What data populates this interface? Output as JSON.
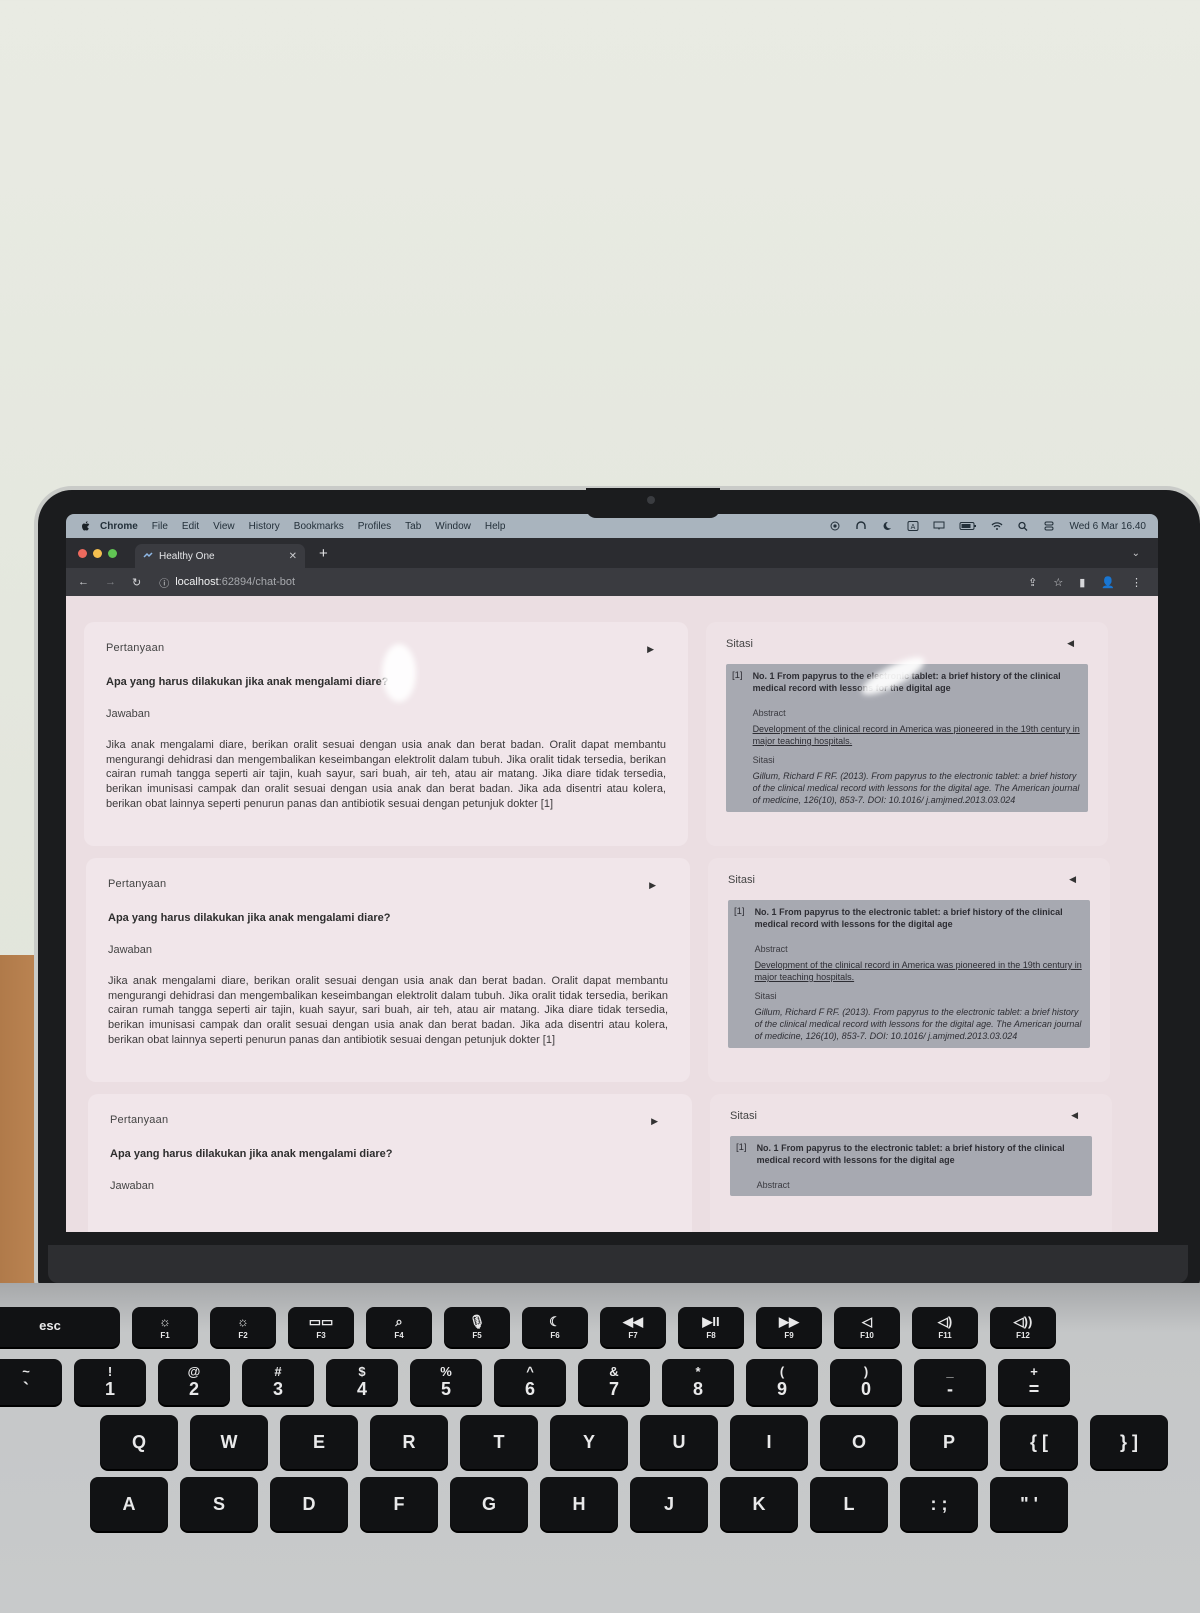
{
  "menubar": {
    "items": [
      "Chrome",
      "File",
      "Edit",
      "View",
      "History",
      "Bookmarks",
      "Profiles",
      "Tab",
      "Window",
      "Help"
    ],
    "datetime": "Wed 6 Mar  16.40"
  },
  "browser": {
    "tab_title": "Healthy One",
    "url_host": "localhost",
    "url_path": ":62894/chat-bot"
  },
  "cards": [
    {
      "question_label": "Pertanyaan",
      "question": "Apa yang harus dilakukan jika anak mengalami diare?",
      "answer_label": "Jawaban",
      "answer": "Jika anak mengalami diare, berikan oralit sesuai dengan usia anak dan berat badan. Oralit dapat membantu mengurangi dehidrasi dan mengembalikan keseimbangan elektrolit dalam tubuh. Jika oralit tidak tersedia, berikan cairan rumah tangga seperti air tajin, kuah sayur, sari buah, air teh, atau air matang. Jika diare tidak tersedia, berikan imunisasi campak dan oralit sesuai dengan usia anak dan berat badan. Jika ada disentri atau kolera, berikan obat lainnya seperti penurun panas dan antibiotik sesuai dengan petunjuk dokter [1]",
      "citation_title": "Sitasi",
      "citation_num": "[1]",
      "citation_paper": "No. 1 From papyrus to the electronic tablet: a brief history of the clinical medical record with lessons for the digital age",
      "abstract_label": "Abstract",
      "abstract": "Development of the clinical record in America was pioneered in the 19th century in major teaching hospitals.",
      "sitasi_label": "Sitasi",
      "reference": "Gillum, Richard F RF. (2013). From papyrus to the electronic tablet: a brief history of the clinical medical record with lessons for the digital age. The American journal of medicine, 126(10), 853-7. DOI: 10.1016/ j.amjmed.2013.03.024"
    },
    {
      "question_label": "Pertanyaan",
      "question": "Apa yang harus dilakukan jika anak mengalami diare?",
      "answer_label": "Jawaban",
      "answer": "Jika anak mengalami diare, berikan oralit sesuai dengan usia anak dan berat badan. Oralit dapat membantu mengurangi dehidrasi dan mengembalikan keseimbangan elektrolit dalam tubuh. Jika oralit tidak tersedia, berikan cairan rumah tangga seperti air tajin, kuah sayur, sari buah, air teh, atau air matang. Jika diare tidak tersedia, berikan imunisasi campak dan oralit sesuai dengan usia anak dan berat badan. Jika ada disentri atau kolera, berikan obat lainnya seperti penurun panas dan antibiotik sesuai dengan petunjuk dokter [1]",
      "citation_title": "Sitasi",
      "citation_num": "[1]",
      "citation_paper": "No. 1 From papyrus to the electronic tablet: a brief history of the clinical medical record with lessons for the digital age",
      "abstract_label": "Abstract",
      "abstract": "Development of the clinical record in America was pioneered in the 19th century in major teaching hospitals.",
      "sitasi_label": "Sitasi",
      "reference": "Gillum, Richard F RF. (2013). From papyrus to the electronic tablet: a brief history of the clinical medical record with lessons for the digital age. The American journal of medicine, 126(10), 853-7. DOI: 10.1016/ j.amjmed.2013.03.024"
    },
    {
      "question_label": "Pertanyaan",
      "question": "Apa yang harus dilakukan jika anak mengalami diare?",
      "answer_label": "Jawaban",
      "citation_title": "Sitasi",
      "citation_num": "[1]",
      "citation_paper": "No. 1 From papyrus to the electronic tablet: a brief history of the clinical medical record with lessons for the digital age",
      "abstract_label": "Abstract"
    }
  ],
  "keyboard": {
    "row_fn": [
      {
        "top": "",
        "bot": "esc",
        "fn": ""
      },
      {
        "top": "☼",
        "bot": "",
        "fn": "F1"
      },
      {
        "top": "☼",
        "bot": "",
        "fn": "F2"
      },
      {
        "top": "▭▭",
        "bot": "",
        "fn": "F3"
      },
      {
        "top": "⌕",
        "bot": "",
        "fn": "F4"
      },
      {
        "top": "🎙",
        "bot": "",
        "fn": "F5"
      },
      {
        "top": "☾",
        "bot": "",
        "fn": "F6"
      },
      {
        "top": "◀◀",
        "bot": "",
        "fn": "F7"
      },
      {
        "top": "▶II",
        "bot": "",
        "fn": "F8"
      },
      {
        "top": "▶▶",
        "bot": "",
        "fn": "F9"
      },
      {
        "top": "◁",
        "bot": "",
        "fn": "F10"
      },
      {
        "top": "◁)",
        "bot": "",
        "fn": "F11"
      },
      {
        "top": "◁))",
        "bot": "",
        "fn": "F12"
      }
    ],
    "row_num": [
      {
        "top": "~",
        "bot": "`"
      },
      {
        "top": "!",
        "bot": "1"
      },
      {
        "top": "@",
        "bot": "2"
      },
      {
        "top": "#",
        "bot": "3"
      },
      {
        "top": "$",
        "bot": "4"
      },
      {
        "top": "%",
        "bot": "5"
      },
      {
        "top": "^",
        "bot": "6"
      },
      {
        "top": "&",
        "bot": "7"
      },
      {
        "top": "*",
        "bot": "8"
      },
      {
        "top": "(",
        "bot": "9"
      },
      {
        "top": ")",
        "bot": "0"
      },
      {
        "top": "_",
        "bot": "-"
      },
      {
        "top": "+",
        "bot": "="
      }
    ],
    "row_q": [
      "Q",
      "W",
      "E",
      "R",
      "T",
      "Y",
      "U",
      "I",
      "O",
      "P",
      "{ [",
      "} ]"
    ],
    "row_a": [
      "A",
      "S",
      "D",
      "F",
      "G",
      "H",
      "J",
      "K",
      "L",
      ": ;",
      "\" '"
    ]
  }
}
